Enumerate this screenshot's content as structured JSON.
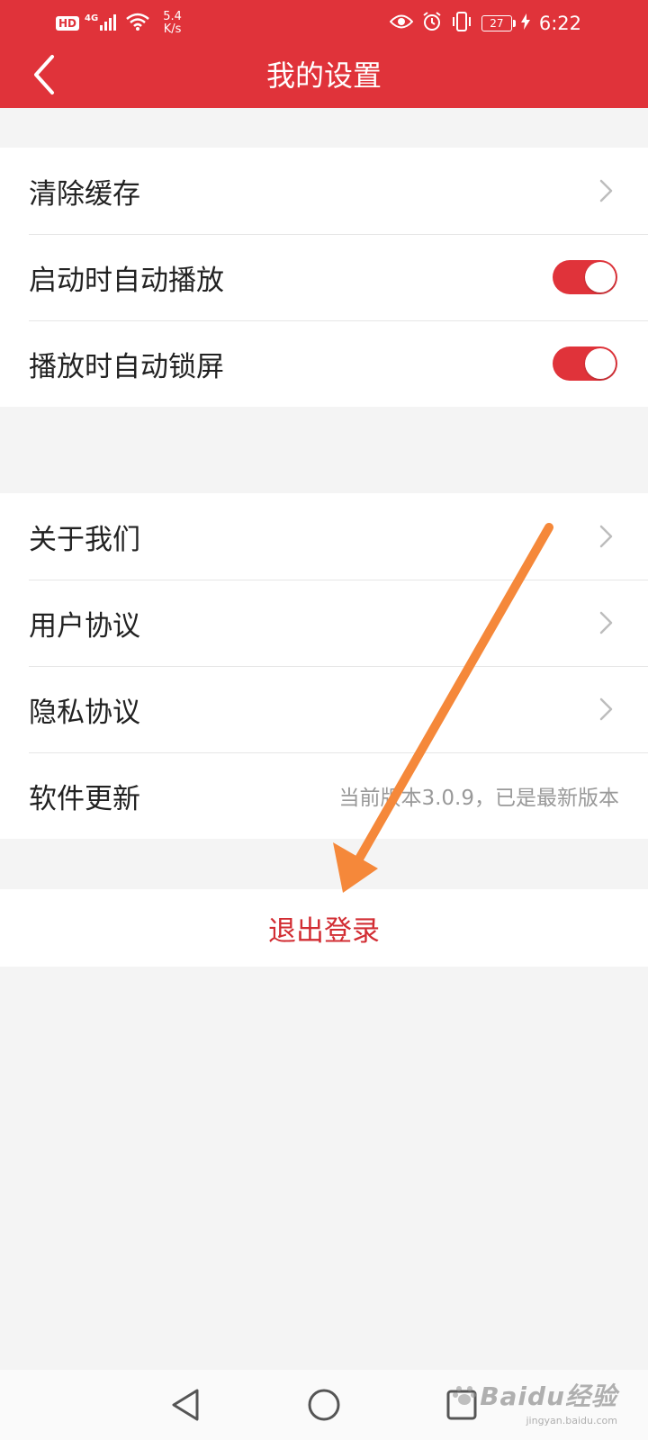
{
  "status_bar": {
    "hd": "HD",
    "network": "4G",
    "net_speed_value": "5.4",
    "net_speed_unit": "K/s",
    "battery": "27",
    "time": "6:22"
  },
  "header": {
    "title": "我的设置",
    "background_color": "#e0333a"
  },
  "group1": {
    "items": [
      {
        "label": "清除缓存",
        "control": "chevron"
      },
      {
        "label": "启动时自动播放",
        "control": "toggle",
        "on": true
      },
      {
        "label": "播放时自动锁屏",
        "control": "toggle",
        "on": true
      }
    ]
  },
  "group2": {
    "items": [
      {
        "label": "关于我们",
        "control": "chevron"
      },
      {
        "label": "用户协议",
        "control": "chevron"
      },
      {
        "label": "隐私协议",
        "control": "chevron"
      },
      {
        "label": "软件更新",
        "value": "当前版本3.0.9，已是最新版本"
      }
    ]
  },
  "logout": {
    "label": "退出登录",
    "color": "#d22d33"
  },
  "annotation": {
    "arrow_color": "#f5883a"
  },
  "watermark": {
    "logo": "Baidu经验",
    "url": "jingyan.baidu.com"
  }
}
